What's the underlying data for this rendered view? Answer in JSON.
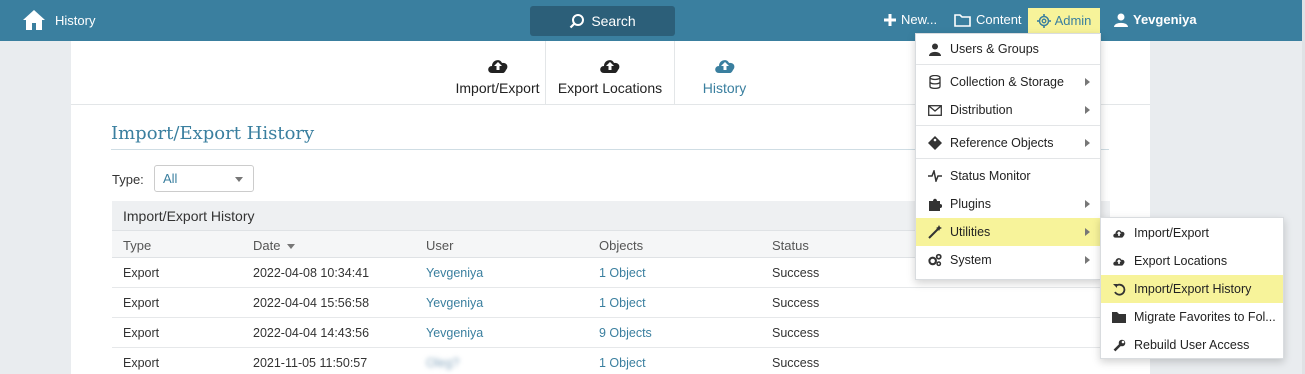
{
  "topbar": {
    "title": "History",
    "search_label": "Search",
    "new_label": "New...",
    "content_label": "Content",
    "admin_label": "Admin",
    "user_name": "Yevgeniya"
  },
  "tabs": [
    {
      "label": "Import/Export",
      "icon": "cloud-upload-icon"
    },
    {
      "label": "Export Locations",
      "icon": "cloud-upload-icon"
    },
    {
      "label": "History",
      "icon": "cloud-upload-icon",
      "active": true
    }
  ],
  "page": {
    "title": "Import/Export History",
    "type_label": "Type:",
    "type_value": "All"
  },
  "table": {
    "caption": "Import/Export History",
    "columns": [
      "Type",
      "Date",
      "User",
      "Objects",
      "Status"
    ],
    "rows": [
      {
        "type": "Export",
        "date": "2022-04-08 10:34:41",
        "user": "Yevgeniya",
        "objects": "1 Object",
        "status": "Success"
      },
      {
        "type": "Export",
        "date": "2022-04-04 15:56:58",
        "user": "Yevgeniya",
        "objects": "1 Object",
        "status": "Success"
      },
      {
        "type": "Export",
        "date": "2022-04-04 14:43:56",
        "user": "Yevgeniya",
        "objects": "9 Objects",
        "status": "Success"
      },
      {
        "type": "Export",
        "date": "2021-11-05 11:50:57",
        "user": "Oleg?",
        "objects": "1 Object",
        "status": "Success"
      }
    ]
  },
  "admin_menu": [
    {
      "label": "Users & Groups",
      "icon": "user-icon"
    },
    {
      "label": "Collection & Storage",
      "icon": "database-icon",
      "submenu": true
    },
    {
      "label": "Distribution",
      "icon": "envelope-icon",
      "submenu": true
    },
    {
      "label": "Reference Objects",
      "icon": "tag-icon",
      "submenu": true
    },
    {
      "label": "Status Monitor",
      "icon": "pulse-icon"
    },
    {
      "label": "Plugins",
      "icon": "puzzle-icon",
      "submenu": true
    },
    {
      "label": "Utilities",
      "icon": "wand-icon",
      "submenu": true,
      "highlighted": true
    },
    {
      "label": "System",
      "icon": "cogs-icon",
      "submenu": true
    }
  ],
  "utilities_submenu": [
    {
      "label": "Import/Export",
      "icon": "cloud-upload-icon"
    },
    {
      "label": "Export Locations",
      "icon": "cloud-upload-icon"
    },
    {
      "label": "Import/Export History",
      "icon": "undo-icon",
      "highlighted": true
    },
    {
      "label": "Migrate Favorites to Fol...",
      "icon": "folder-icon"
    },
    {
      "label": "Rebuild User Access",
      "icon": "wrench-icon"
    }
  ],
  "colors": {
    "topbar": "#3a7f9f",
    "accent": "#3a7f9f",
    "highlight": "#f7f39a"
  }
}
